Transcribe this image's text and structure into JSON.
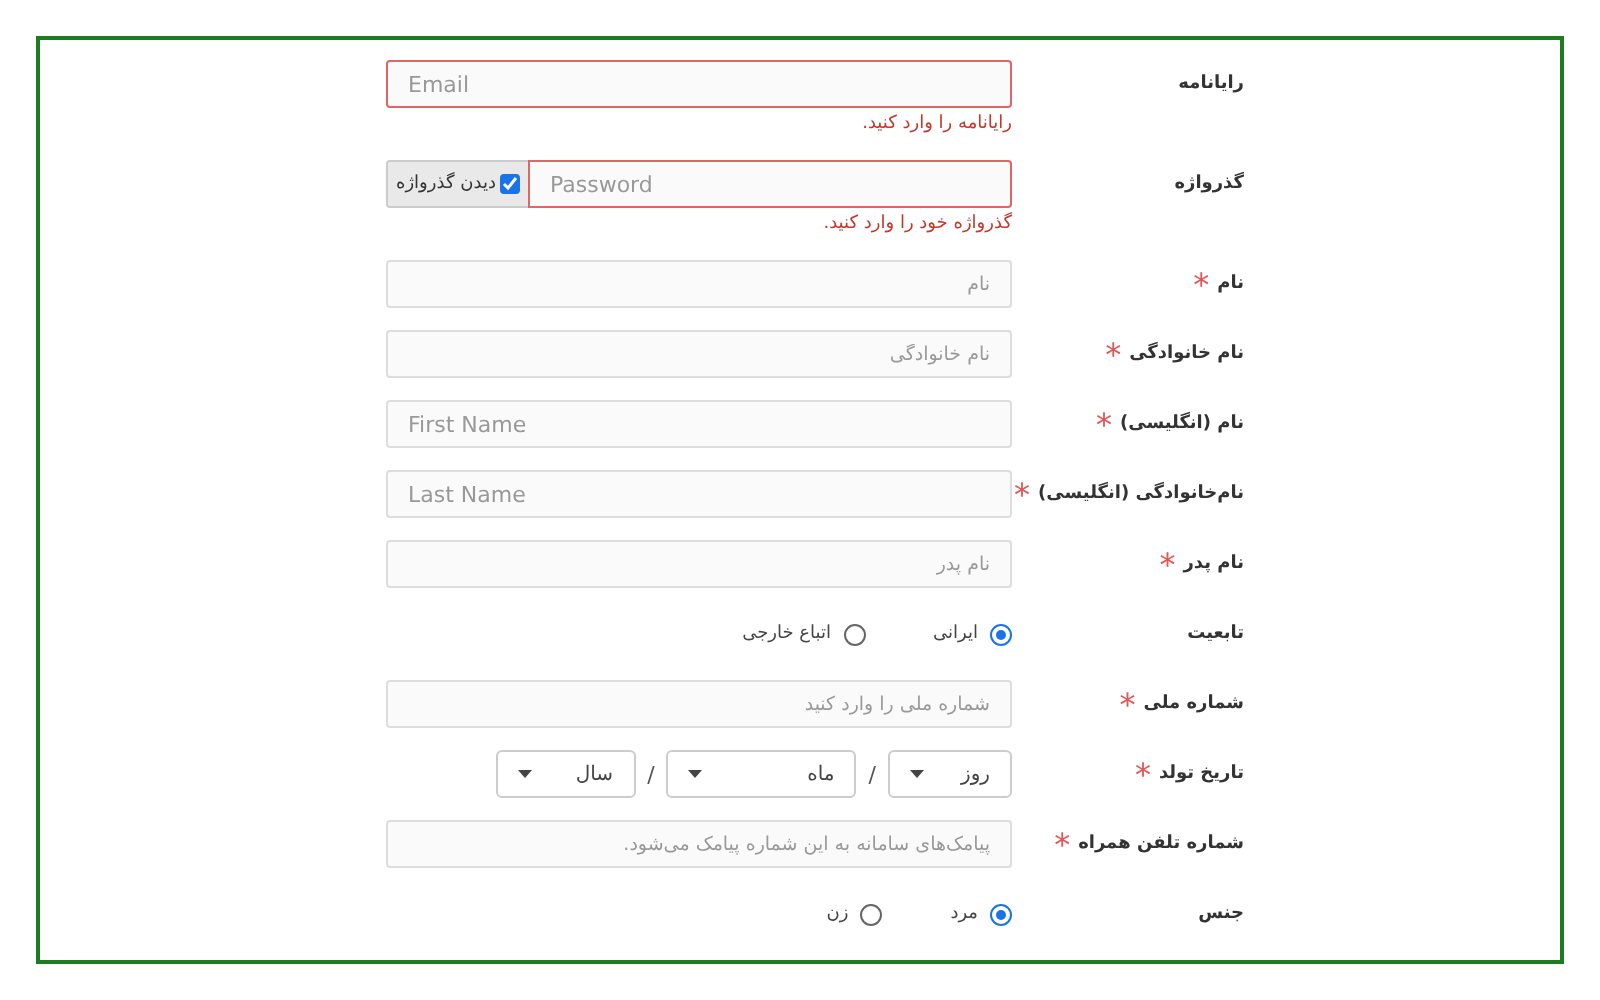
{
  "fields": [
    {
      "kind": "text",
      "label": "رایانامه",
      "placeholder": "Email",
      "latin": true,
      "error": "رایانامه را وارد کنید."
    },
    {
      "kind": "password",
      "label": "گذرواژه",
      "placeholder": "Password",
      "latin": true,
      "error": "گذرواژه خود را وارد کنید.",
      "toggle": {
        "label": "دیدن گذرواژه",
        "checked": true
      }
    },
    {
      "kind": "text",
      "label": "نام",
      "mark": "*",
      "placeholder": "نام",
      "latin": false
    },
    {
      "kind": "text",
      "label": "نام خانوادگی",
      "mark": "*",
      "placeholder": "نام خانوادگی",
      "latin": false
    },
    {
      "kind": "text",
      "label": "نام (انگلیسی)",
      "mark": "*",
      "placeholder": "First Name",
      "latin": true
    },
    {
      "kind": "text",
      "label": "نام‌خانوادگی (انگلیسی)",
      "mark": "*",
      "placeholder": "Last Name",
      "latin": true
    },
    {
      "kind": "text",
      "label": "نام پدر",
      "mark": "*",
      "placeholder": "نام پدر",
      "latin": false
    },
    {
      "kind": "radio",
      "label": "تابعیت",
      "options": [
        {
          "label": "ایرانی",
          "selected": true
        },
        {
          "label": "اتباع خارجی",
          "selected": false
        }
      ]
    },
    {
      "kind": "text",
      "label": "شماره ملی",
      "mark": "*",
      "placeholder": "شماره ملی را وارد کنید",
      "latin": false
    },
    {
      "kind": "date",
      "label": "تاریخ تولد",
      "mark": "*",
      "selects": [
        {
          "value": "روز"
        },
        {
          "value": "ماه"
        },
        {
          "value": "سال"
        }
      ],
      "separators": [
        "/",
        "/"
      ]
    },
    {
      "kind": "text",
      "label": "شماره تلفن همراه",
      "mark": "*",
      "placeholder": "پیامک‌های سامانه به این شماره پیامک می‌شود.",
      "latin": false
    },
    {
      "kind": "radio",
      "label": "جنس",
      "options": [
        {
          "label": "مرد",
          "selected": true
        },
        {
          "label": "زن",
          "selected": false
        }
      ]
    }
  ]
}
